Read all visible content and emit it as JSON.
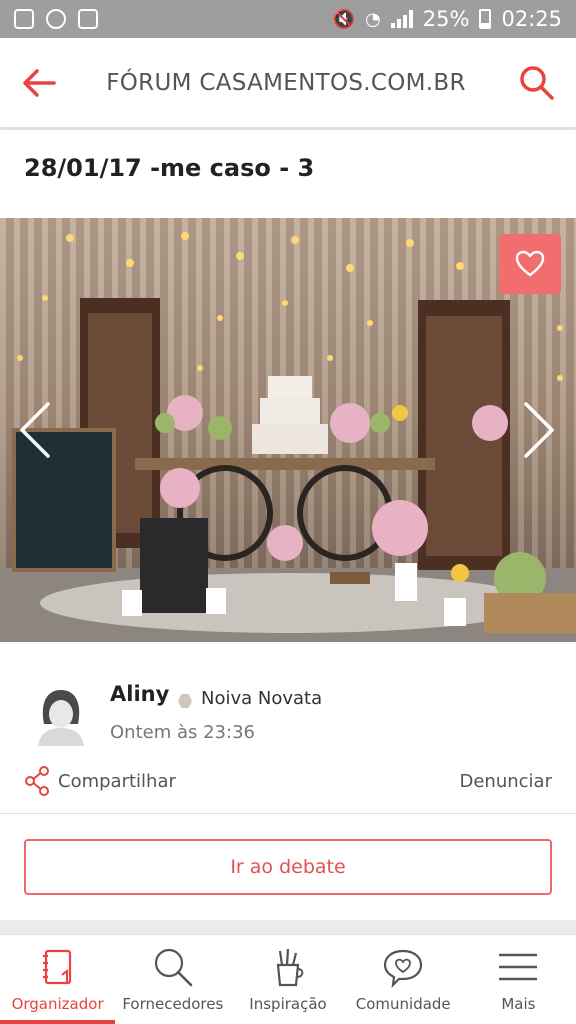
{
  "status_bar": {
    "battery": "25%",
    "time": "02:25"
  },
  "app_bar": {
    "title": "FÓRUM CASAMENTOS.COM.BR"
  },
  "post": {
    "title": "28/01/17 -me caso - 3",
    "author": {
      "name": "Aliny",
      "role": "Noiva Novata",
      "time": "Ontem às 23:36"
    },
    "share_label": "Compartilhar",
    "report_label": "Denunciar",
    "debate_button": "Ir ao debate"
  },
  "bottom_nav": [
    {
      "label": "Organizador",
      "icon": "notebook-icon",
      "active": true
    },
    {
      "label": "Fornecedores",
      "icon": "magnifier-icon"
    },
    {
      "label": "Inspiração",
      "icon": "pencil-cup-icon"
    },
    {
      "label": "Comunidade",
      "icon": "chat-heart-icon"
    },
    {
      "label": "Mais",
      "icon": "menu-icon"
    }
  ],
  "colors": {
    "accent": "#e8433e",
    "favorite_bg": "#f26d6d",
    "status_bar": "#9e9e9e"
  }
}
